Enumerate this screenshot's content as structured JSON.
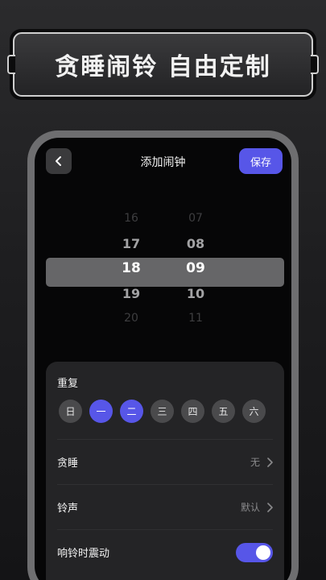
{
  "banner": {
    "text": "贪睡闹铃 自由定制"
  },
  "nav": {
    "title": "添加闹钟",
    "save_label": "保存"
  },
  "picker": {
    "hours": [
      "16",
      "17",
      "18",
      "19",
      "20"
    ],
    "minutes": [
      "07",
      "08",
      "09",
      "10",
      "11"
    ],
    "selected_hour": "18",
    "selected_minute": "09"
  },
  "settings": {
    "repeat_label": "重复",
    "days": [
      {
        "label": "日",
        "active": false
      },
      {
        "label": "一",
        "active": true
      },
      {
        "label": "二",
        "active": true
      },
      {
        "label": "三",
        "active": false
      },
      {
        "label": "四",
        "active": false
      },
      {
        "label": "五",
        "active": false
      },
      {
        "label": "六",
        "active": false
      }
    ],
    "snooze": {
      "label": "贪睡",
      "value": "无"
    },
    "ringtone": {
      "label": "铃声",
      "value": "默认"
    },
    "vibrate": {
      "label": "响铃时震动",
      "on": true
    }
  },
  "colors": {
    "accent": "#5756e8",
    "background": "#060607",
    "card": "#242426"
  }
}
